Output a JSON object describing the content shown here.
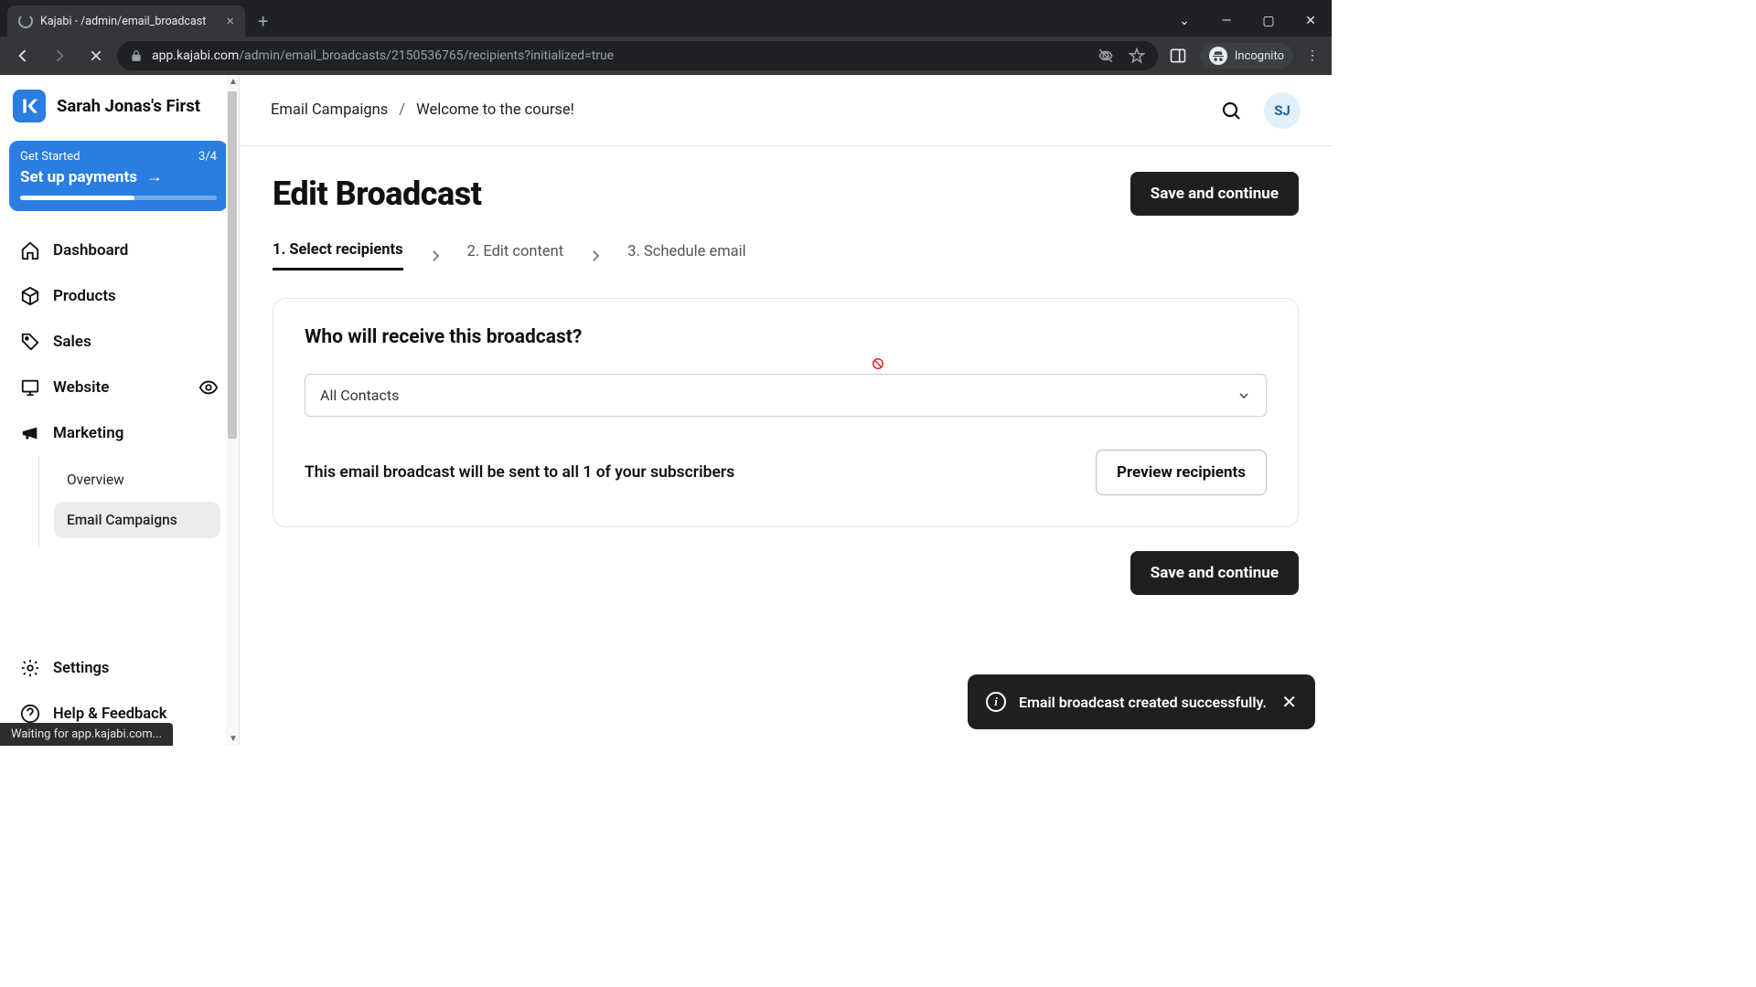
{
  "browser": {
    "tab_title": "Kajabi - /admin/email_broadcast",
    "url_host": "app.kajabi.com",
    "url_path": "/admin/email_broadcasts/2150536765/recipients?initialized=true",
    "incognito_label": "Incognito",
    "status_text": "Waiting for app.kajabi.com..."
  },
  "sidebar": {
    "brand_name": "Sarah Jonas's First",
    "get_started": {
      "label": "Get Started",
      "progress": "3/4",
      "cta": "Set up payments"
    },
    "items": [
      {
        "label": "Dashboard"
      },
      {
        "label": "Products"
      },
      {
        "label": "Sales"
      },
      {
        "label": "Website"
      },
      {
        "label": "Marketing"
      }
    ],
    "marketing_sub": [
      {
        "label": "Overview"
      },
      {
        "label": "Email Campaigns"
      }
    ],
    "bottom": [
      {
        "label": "Settings"
      },
      {
        "label": "Help & Feedback"
      }
    ]
  },
  "header": {
    "breadcrumb_root": "Email Campaigns",
    "breadcrumb_sep": "/",
    "breadcrumb_current": "Welcome to the course!",
    "avatar_initials": "SJ"
  },
  "page": {
    "title": "Edit Broadcast",
    "save_label": "Save and continue",
    "steps": {
      "s1": "1. Select recipients",
      "s2": "2. Edit content",
      "s3": "3. Schedule email"
    },
    "panel": {
      "title": "Who will receive this broadcast?",
      "select_value": "All Contacts",
      "summary": "This email broadcast will be sent to all 1 of your subscribers",
      "preview_label": "Preview recipients"
    }
  },
  "toast": {
    "message": "Email broadcast created successfully."
  }
}
